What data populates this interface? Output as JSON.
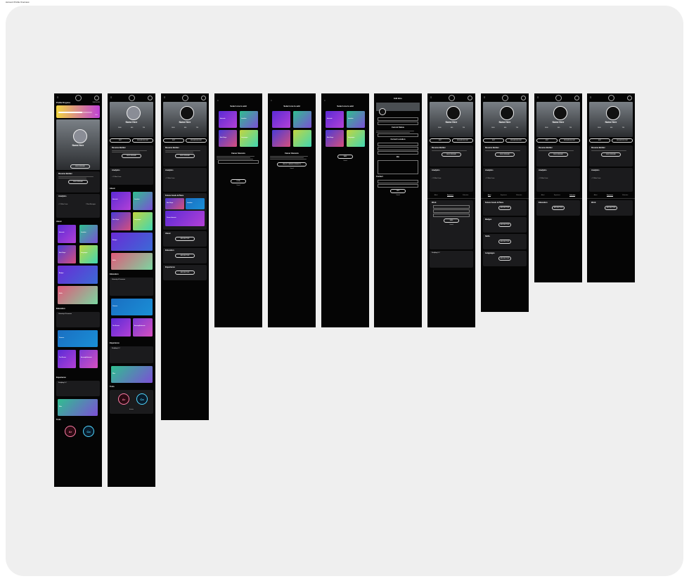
{
  "page_label": "Account Profile Overview",
  "common": {
    "name": "Name Here",
    "stats": [
      "1400",
      "400",
      "720"
    ],
    "edit_label": "EDIT",
    "resume_builder_label": "RESUME BUILDER",
    "build_resume_label": "BUILD RESUME",
    "add_section_label": "ADD SECTION",
    "cancel_label": "Cancel",
    "save_label": "SAVE",
    "done_label": "DONE"
  },
  "screen1": {
    "progress_title": "Profile Progress",
    "progress_action": "VIEW MORE",
    "progress_percent": "70%",
    "resume_title": "Resume Builder",
    "analytics_title": "Analytics",
    "new_users": "+ 12 More Users",
    "new_messages": "2 New Messages",
    "about_title": "About",
    "tiles": [
      "Interests",
      "Location",
      "Next Steps",
      "Languages",
      "Badges",
      "Skills"
    ],
    "education_title": "Education",
    "university": "University of Tennessee",
    "courses": "Courses",
    "test_scores": "Test Scores",
    "accomplishments": "Accomplishments",
    "experience_title": "Experience",
    "company": "Studyblog LLC",
    "files": "Files",
    "tools_title": "Tools",
    "tool_ai": "Ar",
    "tool_co": "Co"
  },
  "screen2": {
    "about_title": "About",
    "tiles": [
      "Interests",
      "Location",
      "Next Steps",
      "Languages",
      "Badges",
      "Skills"
    ],
    "education_title": "Education",
    "university": "University of Tennessee",
    "courses": "Courses",
    "test_scores": "Test Scores",
    "accomplishments": "Accomplishments",
    "experience_title": "Experience",
    "company": "Studyblog LLC",
    "files": "Files",
    "tools_title": "Tools",
    "tool_ai": "Ar",
    "tool_co": "Co",
    "tools_caption": "Activate"
  },
  "screen3": {
    "goals_title": "Future Goals & Plans",
    "tiles": [
      "Next Steps",
      "Location",
      "Career Interests"
    ],
    "about_title": "About",
    "education_title": "Education",
    "experience_title": "Experience"
  },
  "screen4": {
    "title": "Select one to add",
    "tiles": [
      "Interests",
      "Location",
      "Next Steps",
      "Languages"
    ],
    "section_title": "Career Interests",
    "done": "DONE",
    "cancel": "Cancel"
  },
  "screen5": {
    "title": "Select one to add",
    "section_title": "Career Interests",
    "button": "SELECT CAREER INTERESTS",
    "cancel": "Cancel"
  },
  "screen6": {
    "title": "Select one to add",
    "tiles": [
      "Interests",
      "Location",
      "Next Steps",
      "Languages"
    ],
    "save": "SAVE",
    "cancel": "Cancel"
  },
  "screen7": {
    "title": "Edit Intro",
    "status_title": "Current Status",
    "location_title": "Current Location",
    "bio_title": "Bio",
    "contact_title": "Contact",
    "save": "SAVE",
    "cancel": "Cancel"
  },
  "tabs": [
    "About",
    "Experience",
    "Education"
  ],
  "screen8": {
    "work_title": "Work",
    "company": "Studyblog LLC"
  },
  "screen9": {
    "goals_title": "Future Goals & Plans",
    "badges": "Badges",
    "skills": "Skills",
    "languages": "Languages"
  },
  "screen10": {
    "education_title": "Education"
  },
  "screen11": {
    "work_title": "Work"
  }
}
